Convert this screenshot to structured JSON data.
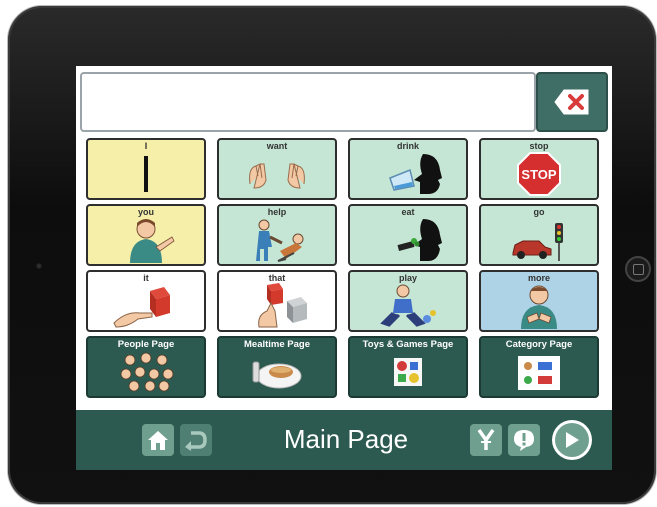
{
  "message_bar": {
    "text": ""
  },
  "clear_button": {
    "icon": "backspace-x-icon",
    "color": "#d83b3b"
  },
  "grid": [
    {
      "label": "I",
      "color": "yellow",
      "icon": "i-letter-icon"
    },
    {
      "label": "want",
      "color": "green",
      "icon": "hands-want-icon"
    },
    {
      "label": "drink",
      "color": "green",
      "icon": "drink-icon"
    },
    {
      "label": "stop",
      "color": "green",
      "icon": "stop-sign-icon",
      "sign_text": "STOP"
    },
    {
      "label": "you",
      "color": "yellow",
      "icon": "person-you-icon"
    },
    {
      "label": "help",
      "color": "green",
      "icon": "help-icon"
    },
    {
      "label": "eat",
      "color": "green",
      "icon": "eat-icon"
    },
    {
      "label": "go",
      "color": "green",
      "icon": "go-car-icon"
    },
    {
      "label": "it",
      "color": "white",
      "icon": "cube-it-icon"
    },
    {
      "label": "that",
      "color": "white",
      "icon": "cube-that-icon"
    },
    {
      "label": "play",
      "color": "green",
      "icon": "play-child-icon"
    },
    {
      "label": "more",
      "color": "blue",
      "icon": "more-sign-icon"
    },
    {
      "label": "People Page",
      "color": "dark",
      "icon": "people-faces-icon"
    },
    {
      "label": "Mealtime Page",
      "color": "dark",
      "icon": "meal-plate-icon"
    },
    {
      "label": "Toys & Games Page",
      "color": "dark",
      "icon": "toys-icon"
    },
    {
      "label": "Category Page",
      "color": "dark",
      "icon": "category-icon"
    }
  ],
  "bottom_bar": {
    "title": "Main Page",
    "buttons": [
      "home-icon",
      "undo-icon",
      "y-tool-icon",
      "alert-icon",
      "play-icon"
    ]
  },
  "colors": {
    "yellow": "#f5efaa",
    "green": "#c5e6d5",
    "blue": "#aed3e6",
    "dark": "#2d5a50",
    "bar": "#2d5a50",
    "button": "#6fa08f"
  }
}
